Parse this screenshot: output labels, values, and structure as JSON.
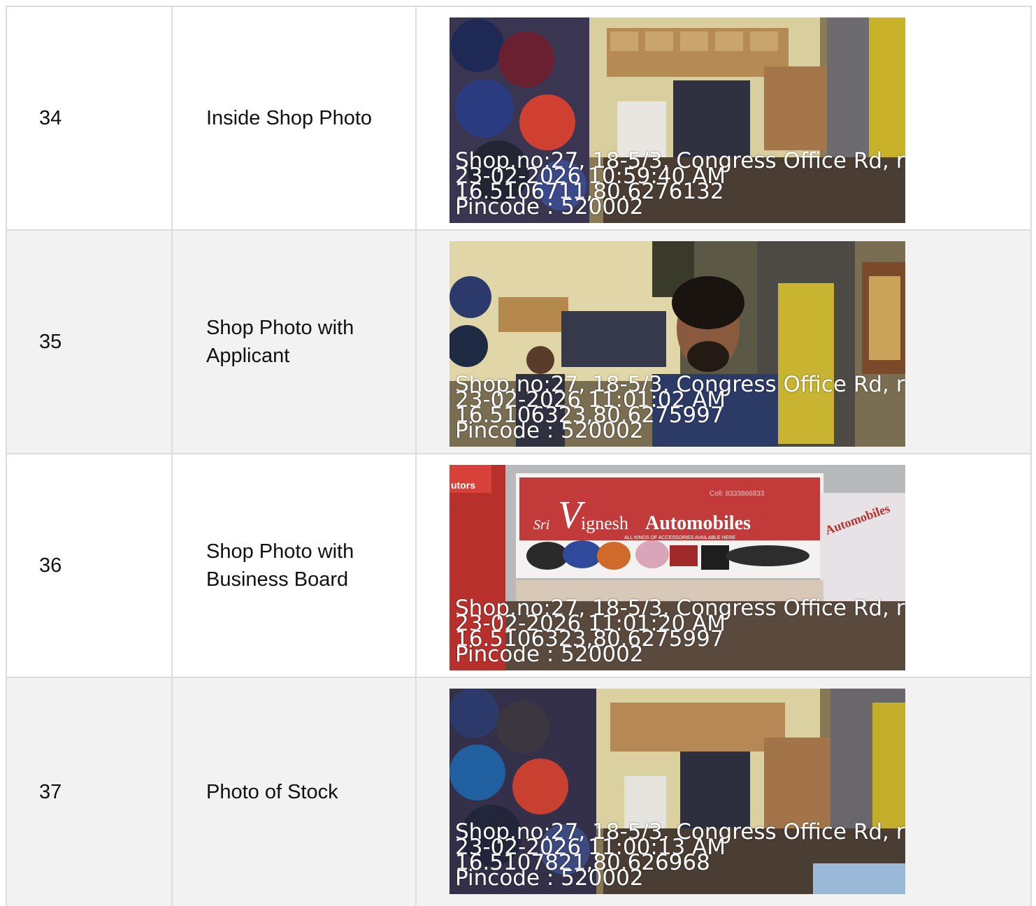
{
  "rows": [
    {
      "number": "34",
      "label": "Inside Shop Photo",
      "photo": {
        "scene": "inside-shop",
        "stamp": {
          "address": "Shop.no:27, 18-5/3, Congress Office Rd, r",
          "datetime": "23-02-2026 10:59:40 AM",
          "coords": "16.5106711,80.6276132",
          "pincode": "Pincode : 520002"
        }
      }
    },
    {
      "number": "35",
      "label": "Shop Photo with Applicant",
      "photo": {
        "scene": "applicant",
        "stamp": {
          "address": "Shop.no:27, 18-5/3, Congress Office Rd, r",
          "datetime": "23-02-2026 11:01:02 AM",
          "coords": "16.5106323,80.6275997",
          "pincode": "Pincode : 520002"
        }
      }
    },
    {
      "number": "36",
      "label": "Shop Photo with Business Board",
      "photo": {
        "scene": "business-board",
        "sign_text": {
          "sri": "Sri",
          "name": "ignesh",
          "automobiles": "Automobiles",
          "tagline": "ALL KINDS OF ACCESSORIES AVAILABLE HERE",
          "cell": "Cell: 8333866833",
          "side_sign": "Automobiles",
          "left_sign": "utors"
        },
        "stamp": {
          "address": "Shop.no:27, 18-5/3, Congress Office Rd, r",
          "datetime": "23-02-2026 11:01:20 AM",
          "coords": "16.5106323,80.6275997",
          "pincode": "Pincode : 520002"
        }
      }
    },
    {
      "number": "37",
      "label": "Photo of Stock",
      "photo": {
        "scene": "stock",
        "stamp": {
          "address": "Shop.no:27, 18-5/3, Congress Office Rd, r",
          "datetime": "23-02-2026 11:00:13 AM",
          "coords": "16.5107821,80.626968",
          "pincode": "Pincode : 520002"
        }
      }
    }
  ]
}
